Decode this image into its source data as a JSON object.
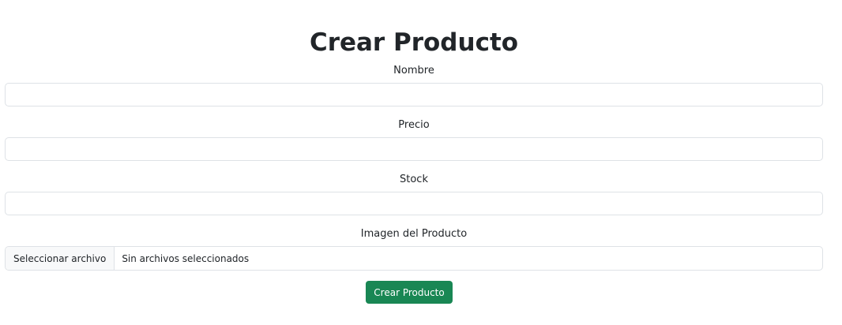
{
  "form": {
    "title": "Crear Producto",
    "fields": [
      {
        "label": "Nombre",
        "value": "",
        "placeholder": ""
      },
      {
        "label": "Precio",
        "value": "",
        "placeholder": ""
      },
      {
        "label": "Stock",
        "value": "",
        "placeholder": ""
      }
    ],
    "image": {
      "label": "Imagen del Producto",
      "button_label": "Seleccionar archivo",
      "status_text": "Sin archivos seleccionados"
    },
    "submit_label": "Crear Producto"
  },
  "colors": {
    "submit_bg": "#198754",
    "input_border": "#dee2e6",
    "file_button_bg": "#f8f9fa"
  }
}
